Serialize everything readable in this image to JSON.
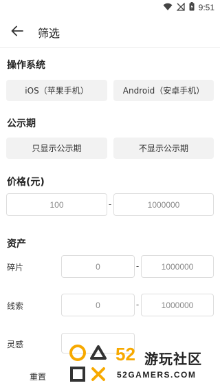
{
  "status_bar": {
    "time": "9:51"
  },
  "header": {
    "title": "筛选"
  },
  "os": {
    "title": "操作系统",
    "options": [
      "iOS（苹果手机）",
      "Android（安卓手机）"
    ]
  },
  "period": {
    "title": "公示期",
    "options": [
      "只显示公示期",
      "不显示公示期"
    ]
  },
  "price": {
    "title": "价格(元)",
    "min_placeholder": "100",
    "max_placeholder": "1000000",
    "separator": "-"
  },
  "assets": {
    "title": "资产",
    "rows": [
      {
        "label": "碎片",
        "min_placeholder": "0",
        "max_placeholder": "1000000"
      },
      {
        "label": "线索",
        "min_placeholder": "0",
        "max_placeholder": "1000000"
      },
      {
        "label": "灵感"
      }
    ],
    "separator": "-"
  },
  "footer": {
    "reset_label": "重置"
  },
  "watermark": {
    "number": "52",
    "name": "游玩社区",
    "url": "52GAMERS.COM"
  }
}
